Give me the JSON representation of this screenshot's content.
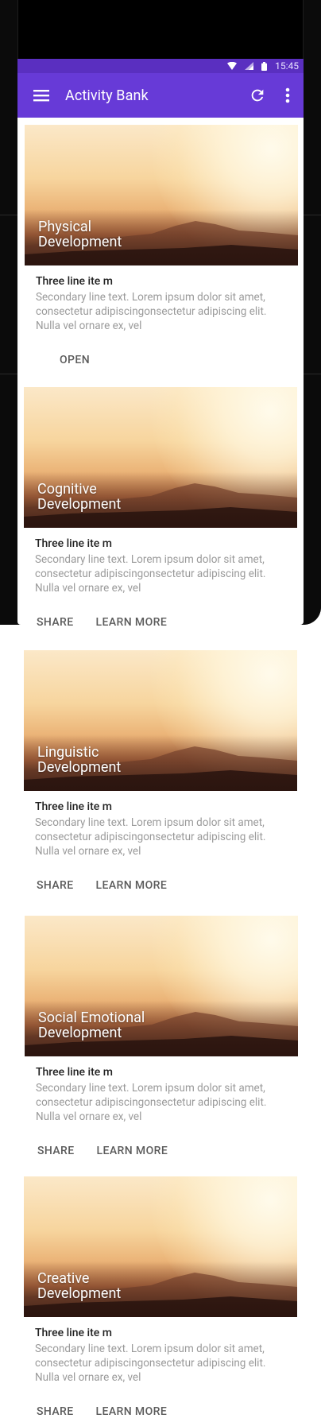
{
  "status_bar": {
    "time": "15:45"
  },
  "app_bar": {
    "title": "Activity Bank"
  },
  "colors": {
    "status_bar": "#5a2fc0",
    "app_bar": "#673ad7",
    "secondary_text": "#9a9a9a"
  },
  "cards": [
    {
      "title_line1": "Physical",
      "title_line2": "Development",
      "primary": "Three line ite  m",
      "secondary": "Secondary line text. Lorem ipsum dolor sit amet, consectetur adipiscingonsectetur adipiscing  elit. Nulla vel ornare ex, vel",
      "action_open": "OPEN"
    },
    {
      "title_line1": "Cognitive",
      "title_line2": "Development",
      "primary": "Three line ite  m",
      "secondary": "Secondary line text. Lorem ipsum dolor sit amet, consectetur adipiscingonsectetur adipiscing  elit. Nulla vel ornare ex, vel",
      "action_share": "SHARE",
      "action_learn": "LEARN MORE"
    },
    {
      "title_line1": "Linguistic",
      "title_line2": "Development",
      "primary": "Three line ite  m",
      "secondary": "Secondary line text. Lorem ipsum dolor sit amet, consectetur adipiscingonsectetur adipiscing  elit. Nulla vel ornare ex, vel",
      "action_share": "SHARE",
      "action_learn": "LEARN MORE"
    },
    {
      "title_line1": "Social Emotional",
      "title_line2": "Development",
      "primary": "Three line ite  m",
      "secondary": "Secondary line text. Lorem ipsum dolor sit amet, consectetur adipiscingonsectetur adipiscing  elit. Nulla vel ornare ex, vel",
      "action_share": "SHARE",
      "action_learn": "LEARN MORE"
    },
    {
      "title_line1": "Creative",
      "title_line2": "Development",
      "primary": "Three line ite  m",
      "secondary": "Secondary line text. Lorem ipsum dolor sit amet, consectetur adipiscingonsectetur adipiscing  elit. Nulla vel ornare ex, vel",
      "action_share": "SHARE",
      "action_learn": "LEARN MORE"
    }
  ]
}
